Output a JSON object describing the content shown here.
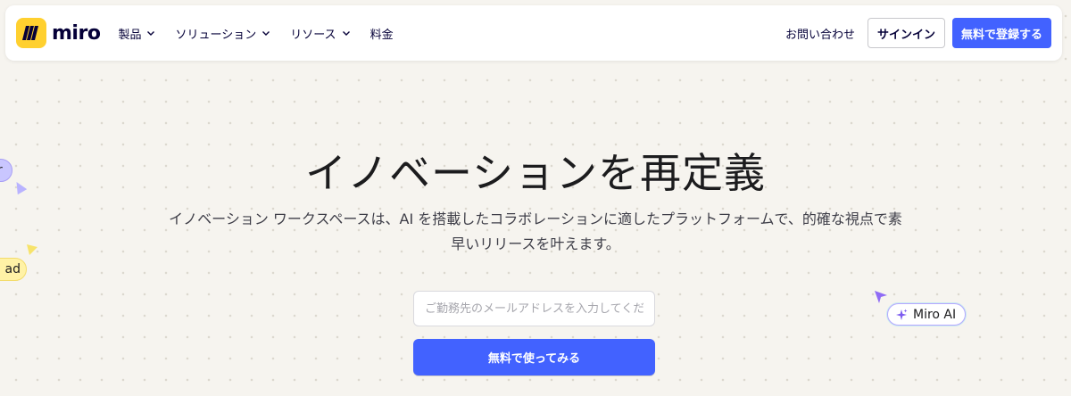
{
  "header": {
    "logo_text": "miro",
    "nav": [
      {
        "label": "製品"
      },
      {
        "label": "ソリューション"
      },
      {
        "label": "リソース"
      },
      {
        "label": "料金"
      }
    ],
    "contact_label": "お問い合わせ",
    "signin_label": "サインイン",
    "signup_label": "無料で登録する"
  },
  "hero": {
    "title": "イノベーションを再定義",
    "subtitle_line1": "イノベーション ワークスペースは、AI を搭載したコラボレーションに適したプラットフォームで、的確な視点で素",
    "subtitle_line2": "早いリリースを叶えます。",
    "email_placeholder": "ご勤務先のメールアドレスを入力してくださ",
    "cta_label": "無料で使ってみる"
  },
  "floating": {
    "left_top_text": "r",
    "left_bottom_text": "ad",
    "miro_ai_label": "Miro AI"
  },
  "colors": {
    "accent": "#4262ff",
    "logo_yellow": "#ffd02f",
    "background": "#f6f4ef"
  }
}
